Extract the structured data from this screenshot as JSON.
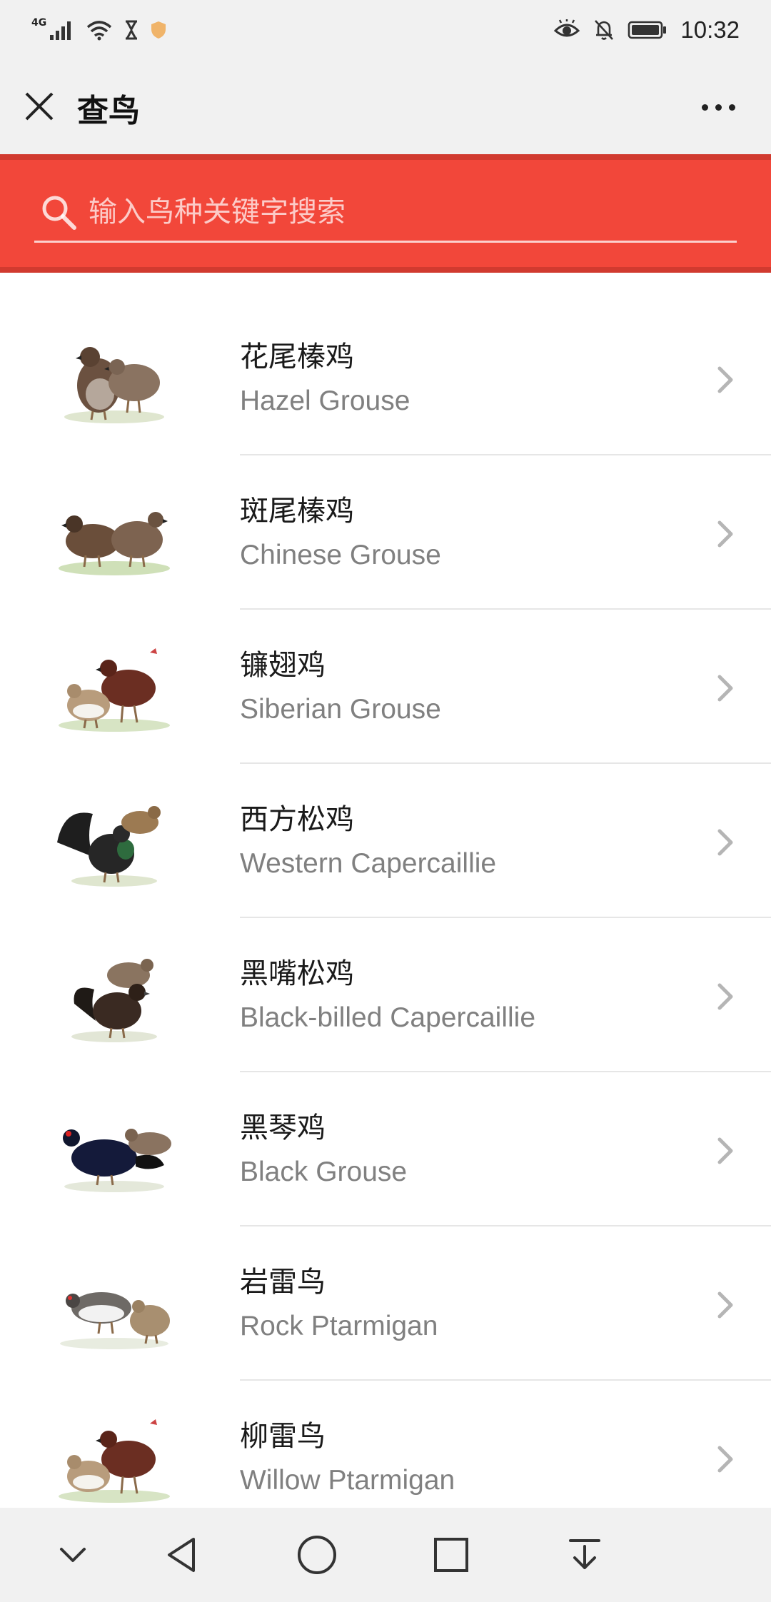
{
  "status_bar": {
    "network": "4G",
    "time": "10:32",
    "icons": [
      "signal-icon",
      "wifi-icon",
      "hourglass-icon",
      "shield-icon",
      "eye-icon",
      "bell-off-icon",
      "battery-icon"
    ]
  },
  "title_bar": {
    "title": "查鸟",
    "close_icon": "close-icon",
    "more_icon": "more-icon"
  },
  "search": {
    "placeholder": "输入鸟种关键字搜索",
    "icon": "search-icon"
  },
  "birds": [
    {
      "cn": "花尾榛鸡",
      "en": "Hazel Grouse"
    },
    {
      "cn": "斑尾榛鸡",
      "en": "Chinese Grouse"
    },
    {
      "cn": "镰翅鸡",
      "en": "Siberian Grouse"
    },
    {
      "cn": "西方松鸡",
      "en": "Western Capercaillie"
    },
    {
      "cn": "黑嘴松鸡",
      "en": "Black-billed Capercaillie"
    },
    {
      "cn": "黑琴鸡",
      "en": "Black Grouse"
    },
    {
      "cn": "岩雷鸟",
      "en": "Rock Ptarmigan"
    },
    {
      "cn": "柳雷鸟",
      "en": "Willow Ptarmigan"
    }
  ],
  "nav_bar": {
    "icons": [
      "chevron-down-icon",
      "back-icon",
      "home-icon",
      "recents-icon",
      "download-icon"
    ]
  },
  "colors": {
    "accent": "#f2473a",
    "accent_dark": "#d13a2f",
    "bar_background": "#f1f1f1"
  }
}
